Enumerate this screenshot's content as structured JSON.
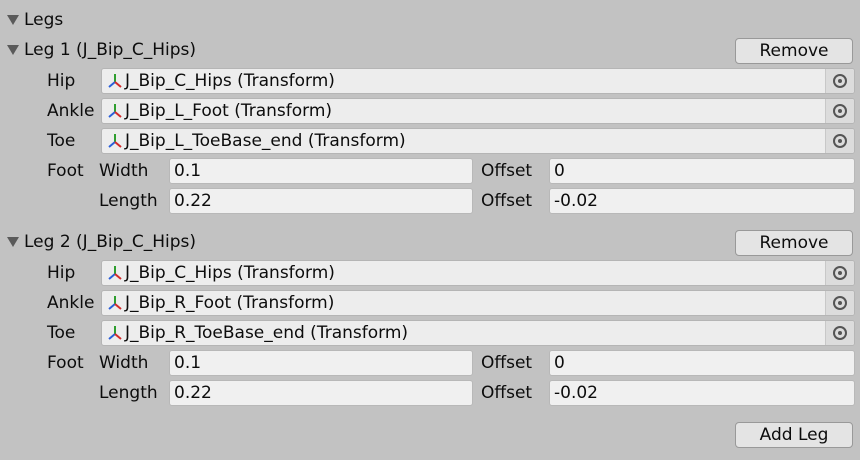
{
  "section": {
    "title": "Legs"
  },
  "legs": [
    {
      "title": "Leg 1 (J_Bip_C_Hips)",
      "remove_label": "Remove",
      "hip": {
        "label": "Hip",
        "value": "J_Bip_C_Hips (Transform)"
      },
      "ankle": {
        "label": "Ankle",
        "value": "J_Bip_L_Foot (Transform)"
      },
      "toe": {
        "label": "Toe",
        "value": "J_Bip_L_ToeBase_end (Transform)"
      },
      "foot": {
        "label": "Foot",
        "width_label": "Width",
        "width_value": "0.1",
        "width_offset_label": "Offset",
        "width_offset_value": "0",
        "length_label": "Length",
        "length_value": "0.22",
        "length_offset_label": "Offset",
        "length_offset_value": "-0.02"
      }
    },
    {
      "title": "Leg 2 (J_Bip_C_Hips)",
      "remove_label": "Remove",
      "hip": {
        "label": "Hip",
        "value": "J_Bip_C_Hips (Transform)"
      },
      "ankle": {
        "label": "Ankle",
        "value": "J_Bip_R_Foot (Transform)"
      },
      "toe": {
        "label": "Toe",
        "value": "J_Bip_R_ToeBase_end (Transform)"
      },
      "foot": {
        "label": "Foot",
        "width_label": "Width",
        "width_value": "0.1",
        "width_offset_label": "Offset",
        "width_offset_value": "0",
        "length_label": "Length",
        "length_value": "0.22",
        "length_offset_label": "Offset",
        "length_offset_value": "-0.02"
      }
    }
  ],
  "add_leg_label": "Add Leg",
  "icons": {
    "transform": "transform-icon",
    "picker": "object-picker-icon",
    "foldout": "foldout-triangle-icon"
  },
  "colors": {
    "background": "#c2c2c2",
    "field": "#ededed",
    "button": "#e4e4e4"
  }
}
